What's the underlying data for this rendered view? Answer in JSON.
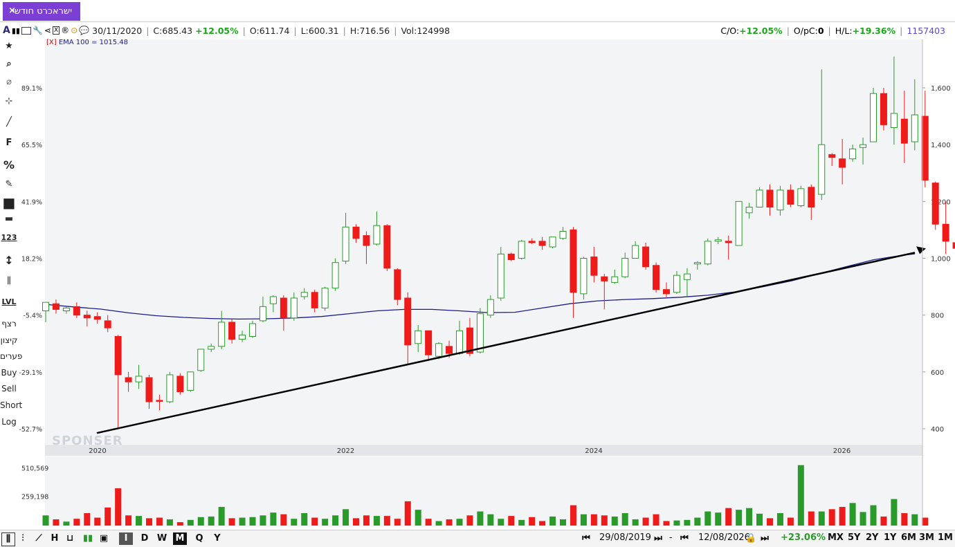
{
  "tab": {
    "title": "ישראכרט חודשי",
    "close": "×"
  },
  "info": {
    "date": "30/11/2020",
    "close_label": "C:",
    "close_value": "685.43",
    "change": "+12.05%",
    "open_label": "O:",
    "open_value": "611.74",
    "low_label": "L:",
    "low_value": "600.31",
    "high_label": "H:",
    "high_value": "716.56",
    "vol_label": "Vol:",
    "vol_value": "124998",
    "co_label": "C/O:",
    "co_value": "+12.05%",
    "opc_label": "O/pC:",
    "opc_value": "0",
    "hl_label": "H/L:",
    "hl_value": "+19.36%",
    "count": "1157403"
  },
  "ema_label": {
    "x": "[X]",
    "text": "EMA 100 = 1015.48"
  },
  "sidebar": {
    "items": [
      "★",
      "⌕",
      "⌀",
      "⊹",
      "╱",
      "F",
      "%",
      "✎",
      "■",
      "▬",
      "123",
      "↕",
      "⫼",
      "LVL",
      "רצף",
      "קיצון",
      "פערים",
      "Buy",
      "Sell",
      "Short",
      "Log"
    ]
  },
  "watermark": "SPONSER",
  "colors": {
    "up": "#2a9a2a",
    "down": "#ee1b1b",
    "ema": "#1a1a8c",
    "trend": "#000000",
    "accent": "#7b3fd6"
  },
  "bottom": {
    "periods": [
      "D",
      "W",
      "M",
      "Q",
      "Y"
    ],
    "active_period": "M",
    "start_date": "29/08/2019",
    "end_date": "12/08/2026",
    "range_change": "+23.06%",
    "ranges": [
      "MX",
      "5Y",
      "2Y",
      "1Y",
      "6M",
      "3M",
      "1M"
    ]
  },
  "chart_data": {
    "type": "candlestick",
    "x_ticks": [
      "2020",
      "2022",
      "2024",
      "2026"
    ],
    "y_right_ticks": [
      "400",
      "600",
      "800",
      "1,000",
      "1,200",
      "1,400",
      "1,600"
    ],
    "y_left_ticks": [
      "-52.7%",
      "-29.1%",
      "-5.4%",
      "18.2%",
      "41.9%",
      "65.5%",
      "89.1%"
    ],
    "volume_ticks": [
      "259,198",
      "510,569"
    ],
    "ylim": [
      340,
      1700
    ],
    "candles": [
      {
        "o": 815,
        "h": 840,
        "l": 775,
        "c": 845
      },
      {
        "o": 840,
        "h": 855,
        "l": 805,
        "c": 820
      },
      {
        "o": 815,
        "h": 830,
        "l": 805,
        "c": 825
      },
      {
        "o": 830,
        "h": 845,
        "l": 790,
        "c": 800
      },
      {
        "o": 800,
        "h": 815,
        "l": 760,
        "c": 790
      },
      {
        "o": 795,
        "h": 810,
        "l": 770,
        "c": 785
      },
      {
        "o": 780,
        "h": 800,
        "l": 740,
        "c": 755
      },
      {
        "o": 725,
        "h": 730,
        "l": 405,
        "c": 590
      },
      {
        "o": 580,
        "h": 600,
        "l": 530,
        "c": 565
      },
      {
        "o": 565,
        "h": 625,
        "l": 540,
        "c": 585
      },
      {
        "o": 580,
        "h": 590,
        "l": 470,
        "c": 495
      },
      {
        "o": 500,
        "h": 520,
        "l": 465,
        "c": 498
      },
      {
        "o": 495,
        "h": 600,
        "l": 490,
        "c": 590
      },
      {
        "o": 585,
        "h": 595,
        "l": 520,
        "c": 530
      },
      {
        "o": 535,
        "h": 600,
        "l": 530,
        "c": 600
      },
      {
        "o": 605,
        "h": 680,
        "l": 600,
        "c": 680
      },
      {
        "o": 680,
        "h": 700,
        "l": 670,
        "c": 690
      },
      {
        "o": 690,
        "h": 815,
        "l": 680,
        "c": 775
      },
      {
        "o": 775,
        "h": 785,
        "l": 700,
        "c": 715
      },
      {
        "o": 715,
        "h": 745,
        "l": 705,
        "c": 730
      },
      {
        "o": 725,
        "h": 780,
        "l": 720,
        "c": 770
      },
      {
        "o": 780,
        "h": 865,
        "l": 775,
        "c": 830
      },
      {
        "o": 840,
        "h": 870,
        "l": 810,
        "c": 865
      },
      {
        "o": 860,
        "h": 870,
        "l": 745,
        "c": 790
      },
      {
        "o": 790,
        "h": 880,
        "l": 780,
        "c": 860
      },
      {
        "o": 865,
        "h": 895,
        "l": 855,
        "c": 880
      },
      {
        "o": 880,
        "h": 890,
        "l": 810,
        "c": 825
      },
      {
        "o": 825,
        "h": 900,
        "l": 815,
        "c": 895
      },
      {
        "o": 895,
        "h": 1000,
        "l": 885,
        "c": 985
      },
      {
        "o": 990,
        "h": 1160,
        "l": 980,
        "c": 1110
      },
      {
        "o": 1110,
        "h": 1120,
        "l": 1055,
        "c": 1070
      },
      {
        "o": 1080,
        "h": 1095,
        "l": 980,
        "c": 1045
      },
      {
        "o": 1050,
        "h": 1165,
        "l": 1045,
        "c": 1115
      },
      {
        "o": 1115,
        "h": 1120,
        "l": 955,
        "c": 965
      },
      {
        "o": 960,
        "h": 965,
        "l": 835,
        "c": 855
      },
      {
        "o": 860,
        "h": 880,
        "l": 625,
        "c": 695
      },
      {
        "o": 700,
        "h": 765,
        "l": 670,
        "c": 745
      },
      {
        "o": 745,
        "h": 745,
        "l": 645,
        "c": 660
      },
      {
        "o": 655,
        "h": 705,
        "l": 645,
        "c": 700
      },
      {
        "o": 690,
        "h": 710,
        "l": 650,
        "c": 665
      },
      {
        "o": 665,
        "h": 780,
        "l": 660,
        "c": 745
      },
      {
        "o": 755,
        "h": 790,
        "l": 655,
        "c": 665
      },
      {
        "o": 670,
        "h": 825,
        "l": 665,
        "c": 805
      },
      {
        "o": 800,
        "h": 870,
        "l": 790,
        "c": 855
      },
      {
        "o": 860,
        "h": 1040,
        "l": 850,
        "c": 1015
      },
      {
        "o": 1015,
        "h": 1020,
        "l": 990,
        "c": 995
      },
      {
        "o": 1000,
        "h": 1065,
        "l": 995,
        "c": 1060
      },
      {
        "o": 1060,
        "h": 1070,
        "l": 1050,
        "c": 1055
      },
      {
        "o": 1060,
        "h": 1075,
        "l": 1030,
        "c": 1045
      },
      {
        "o": 1040,
        "h": 1075,
        "l": 1035,
        "c": 1075
      },
      {
        "o": 1070,
        "h": 1110,
        "l": 1065,
        "c": 1095
      },
      {
        "o": 1100,
        "h": 1110,
        "l": 790,
        "c": 880
      },
      {
        "o": 875,
        "h": 1005,
        "l": 855,
        "c": 1000
      },
      {
        "o": 1005,
        "h": 1040,
        "l": 915,
        "c": 940
      },
      {
        "o": 935,
        "h": 945,
        "l": 820,
        "c": 920
      },
      {
        "o": 915,
        "h": 960,
        "l": 910,
        "c": 935
      },
      {
        "o": 935,
        "h": 1020,
        "l": 930,
        "c": 1000
      },
      {
        "o": 1000,
        "h": 1060,
        "l": 1000,
        "c": 1045
      },
      {
        "o": 1040,
        "h": 1055,
        "l": 960,
        "c": 970
      },
      {
        "o": 975,
        "h": 985,
        "l": 880,
        "c": 890
      },
      {
        "o": 890,
        "h": 915,
        "l": 860,
        "c": 875
      },
      {
        "o": 880,
        "h": 955,
        "l": 875,
        "c": 940
      },
      {
        "o": 925,
        "h": 965,
        "l": 865,
        "c": 945
      },
      {
        "o": 980,
        "h": 990,
        "l": 960,
        "c": 985
      },
      {
        "o": 980,
        "h": 1070,
        "l": 975,
        "c": 1060
      },
      {
        "o": 1060,
        "h": 1075,
        "l": 1050,
        "c": 1065
      },
      {
        "o": 1060,
        "h": 1080,
        "l": 995,
        "c": 1055
      },
      {
        "o": 1045,
        "h": 1200,
        "l": 1045,
        "c": 1200
      },
      {
        "o": 1160,
        "h": 1195,
        "l": 1140,
        "c": 1180
      },
      {
        "o": 1180,
        "h": 1250,
        "l": 1180,
        "c": 1240
      },
      {
        "o": 1240,
        "h": 1260,
        "l": 1150,
        "c": 1180
      },
      {
        "o": 1170,
        "h": 1255,
        "l": 1150,
        "c": 1240
      },
      {
        "o": 1240,
        "h": 1260,
        "l": 1180,
        "c": 1190
      },
      {
        "o": 1185,
        "h": 1255,
        "l": 1180,
        "c": 1245
      },
      {
        "o": 1250,
        "h": 1260,
        "l": 1135,
        "c": 1180
      },
      {
        "o": 1225,
        "h": 1665,
        "l": 1205,
        "c": 1400
      },
      {
        "o": 1365,
        "h": 1370,
        "l": 1325,
        "c": 1355
      },
      {
        "o": 1350,
        "h": 1420,
        "l": 1260,
        "c": 1320
      },
      {
        "o": 1350,
        "h": 1400,
        "l": 1340,
        "c": 1385
      },
      {
        "o": 1390,
        "h": 1425,
        "l": 1330,
        "c": 1400
      },
      {
        "o": 1410,
        "h": 1600,
        "l": 1415,
        "c": 1580
      },
      {
        "o": 1580,
        "h": 1600,
        "l": 1450,
        "c": 1470
      },
      {
        "o": 1460,
        "h": 1710,
        "l": 1400,
        "c": 1510
      },
      {
        "o": 1490,
        "h": 1590,
        "l": 1335,
        "c": 1405
      },
      {
        "o": 1410,
        "h": 1630,
        "l": 1380,
        "c": 1505
      },
      {
        "o": 1500,
        "h": 1590,
        "l": 1250,
        "c": 1275
      },
      {
        "o": 1265,
        "h": 1270,
        "l": 1100,
        "c": 1120
      },
      {
        "o": 1120,
        "h": 1200,
        "l": 1015,
        "c": 1060
      },
      {
        "o": 1055,
        "h": 1080,
        "l": 1025,
        "c": 1035
      }
    ],
    "volume_scale_max": 600000,
    "volumes": [
      90000,
      55000,
      35000,
      60000,
      110000,
      70000,
      160000,
      330000,
      90000,
      85000,
      65000,
      70000,
      55000,
      30000,
      50000,
      75000,
      80000,
      165000,
      65000,
      70000,
      75000,
      90000,
      115000,
      100000,
      60000,
      110000,
      70000,
      60000,
      90000,
      145000,
      65000,
      90000,
      85000,
      85000,
      60000,
      215000,
      140000,
      60000,
      40000,
      55000,
      60000,
      90000,
      125000,
      100000,
      60000,
      85000,
      50000,
      75000,
      40000,
      80000,
      55000,
      180000,
      100000,
      100000,
      90000,
      80000,
      110000,
      55000,
      70000,
      100000,
      40000,
      45000,
      50000,
      70000,
      125000,
      115000,
      155000,
      140000,
      155000,
      105000,
      65000,
      110000,
      70000,
      535000,
      125000,
      125000,
      145000,
      165000,
      200000,
      120000,
      180000,
      80000,
      235000,
      110000,
      100000,
      70000
    ],
    "ema100": [
      [
        0,
        838
      ],
      [
        40,
        829
      ],
      [
        80,
        821
      ],
      [
        120,
        808
      ],
      [
        160,
        798
      ],
      [
        200,
        792
      ],
      [
        240,
        788
      ],
      [
        280,
        786
      ],
      [
        320,
        787
      ],
      [
        360,
        790
      ],
      [
        400,
        795
      ],
      [
        440,
        805
      ],
      [
        480,
        815
      ],
      [
        520,
        820
      ],
      [
        560,
        820
      ],
      [
        600,
        815
      ],
      [
        640,
        809
      ],
      [
        680,
        810
      ],
      [
        720,
        825
      ],
      [
        760,
        840
      ],
      [
        800,
        850
      ],
      [
        840,
        855
      ],
      [
        880,
        858
      ],
      [
        920,
        863
      ],
      [
        960,
        870
      ],
      [
        1000,
        882
      ],
      [
        1040,
        900
      ],
      [
        1080,
        920
      ],
      [
        1120,
        945
      ],
      [
        1160,
        970
      ],
      [
        1200,
        995
      ],
      [
        1240,
        1010
      ],
      [
        1260,
        1015.48
      ]
    ],
    "trendline": {
      "start": [
        0,
        385
      ],
      "end": [
        1260,
        1020
      ]
    }
  }
}
